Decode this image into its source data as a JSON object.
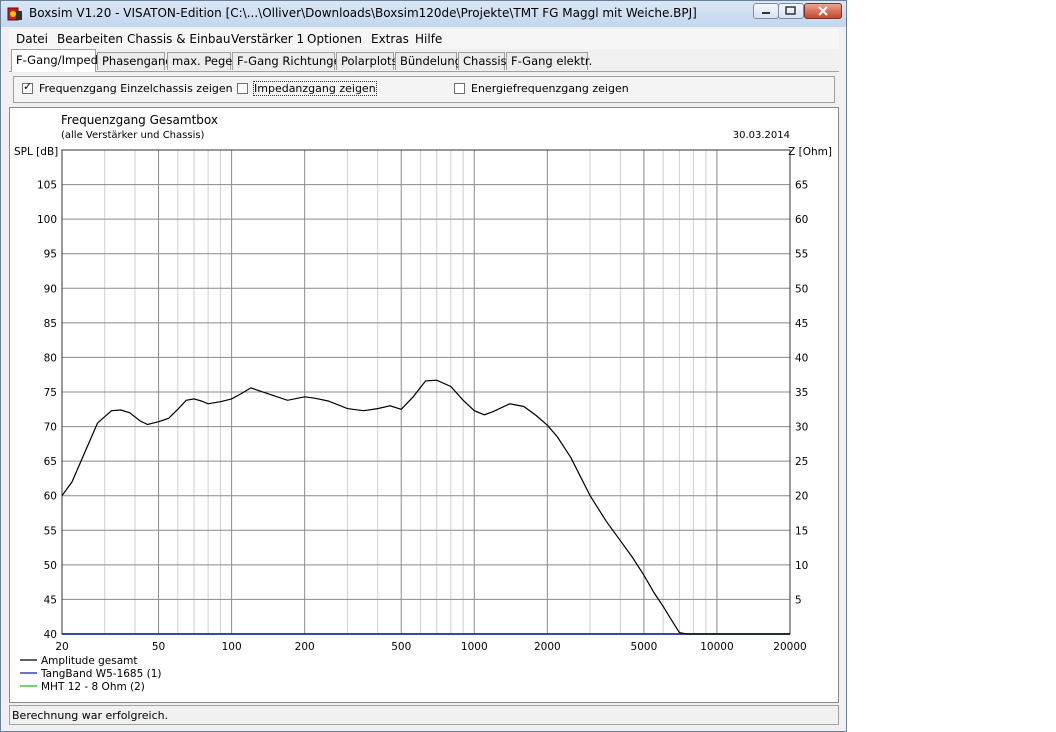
{
  "window": {
    "title": "Boxsim V1.20 - VISATON-Edition [C:\\...\\Olliver\\Downloads\\Boxsim120de\\Projekte\\TMT FG Maggl mit Weiche.BPJ]"
  },
  "menu": [
    "Datei",
    "Bearbeiten",
    "Chassis & Einbau",
    "Verstärker 1",
    "Optionen",
    "Extras",
    "Hilfe"
  ],
  "tabs": [
    "F-Gang/Imped.",
    "Phasengang",
    "max. Pegel",
    "F-Gang Richtungen",
    "Polarplots",
    "Bündelung",
    "Chassis",
    "F-Gang elektr."
  ],
  "options": [
    {
      "label": "Frequenzgang Einzelchassis zeigen",
      "checked": true
    },
    {
      "label": "Impedanzgang zeigen",
      "checked": false
    },
    {
      "label": "Energiefrequenzgang zeigen",
      "checked": false
    }
  ],
  "status": "Berechnung war erfolgreich.",
  "chart_data": {
    "type": "line",
    "title": "Frequenzgang Gesamtbox",
    "subtitle": "(alle Verstärker und Chassis)",
    "date": "30.03.2014",
    "ylabel": "SPL [dB]",
    "y2label": "Z [Ohm]",
    "xscale": "log",
    "xlim": [
      20,
      20000
    ],
    "ylim": [
      40,
      110
    ],
    "y2lim": [
      0,
      70
    ],
    "xticks": [
      20,
      50,
      100,
      200,
      500,
      1000,
      2000,
      5000,
      10000,
      20000
    ],
    "yticks": [
      40,
      45,
      50,
      55,
      60,
      65,
      70,
      75,
      80,
      85,
      90,
      95,
      100,
      105
    ],
    "y2ticks": [
      5,
      10,
      15,
      20,
      25,
      30,
      35,
      40,
      45,
      50,
      55,
      60,
      65
    ],
    "grid": true,
    "legend_position": "bottom-left",
    "series": [
      {
        "name": "Amplitude gesamt",
        "color": "#000000",
        "x": [
          20,
          22,
          25,
          28,
          32,
          35,
          38,
          42,
          45,
          50,
          55,
          60,
          65,
          70,
          75,
          80,
          90,
          100,
          110,
          120,
          140,
          170,
          200,
          220,
          250,
          300,
          350,
          400,
          450,
          500,
          560,
          630,
          700,
          800,
          900,
          1000,
          1100,
          1200,
          1400,
          1600,
          1800,
          2000,
          2200,
          2500,
          3000,
          3500,
          4000,
          4500,
          5000,
          5500,
          6000,
          6500,
          7000,
          7500,
          8000,
          10000,
          20000
        ],
        "y": [
          60,
          62,
          66.5,
          70.5,
          72.3,
          72.4,
          72,
          70.8,
          70.3,
          70.7,
          71.2,
          72.5,
          73.8,
          74,
          73.7,
          73.3,
          73.6,
          74,
          74.8,
          75.6,
          74.8,
          73.8,
          74.3,
          74.1,
          73.7,
          72.6,
          72.3,
          72.6,
          73,
          72.5,
          74.3,
          76.6,
          76.7,
          75.8,
          73.8,
          72.3,
          71.7,
          72.2,
          73.3,
          72.9,
          71.6,
          70.2,
          68.5,
          65.5,
          60,
          56.3,
          53.5,
          51,
          48.5,
          46,
          44,
          42,
          40.2,
          40,
          40,
          40,
          40
        ]
      },
      {
        "name": "TangBand W5-1685 (1)",
        "color": "#1a1aa6",
        "x": [
          20,
          20000
        ],
        "y": [
          40,
          40
        ]
      },
      {
        "name": "MHT 12 - 8 Ohm (2)",
        "color": "#22b822",
        "x": [
          20,
          20000
        ],
        "y": [
          40,
          40
        ]
      }
    ]
  }
}
